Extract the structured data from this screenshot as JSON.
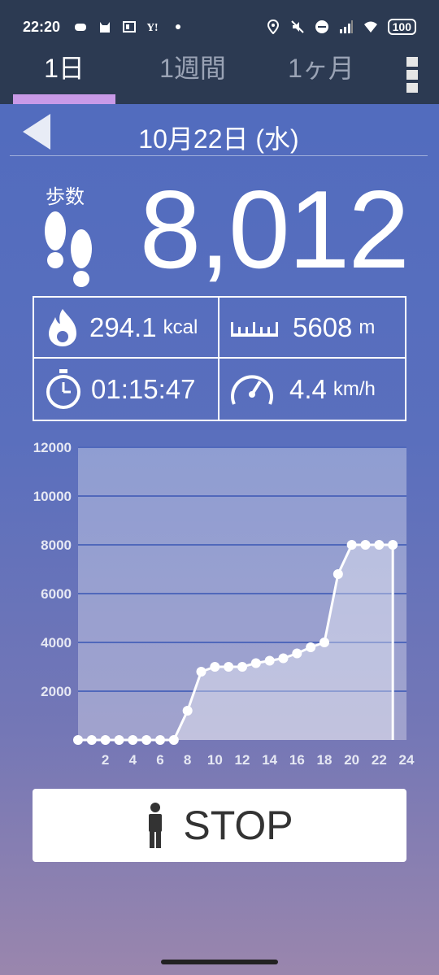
{
  "status": {
    "time": "22:20",
    "battery": "100"
  },
  "tabs": [
    {
      "label": "1日",
      "active": true
    },
    {
      "label": "1週間",
      "active": false
    },
    {
      "label": "1ヶ月",
      "active": false
    }
  ],
  "date": "10月22日 (水)",
  "steps": {
    "label": "歩数",
    "value": "8,012"
  },
  "stats": {
    "calories": {
      "value": "294.1",
      "unit": "kcal"
    },
    "distance": {
      "value": "5608",
      "unit": "m"
    },
    "duration": {
      "value": "01:15:47"
    },
    "speed": {
      "value": "4.4",
      "unit": "km/h"
    }
  },
  "stop_label": "STOP",
  "colors": {
    "header_bg": "#2c3a52",
    "tab_indicator": "#c99ae8"
  },
  "chart_data": {
    "type": "area",
    "x": [
      0,
      1,
      2,
      3,
      4,
      5,
      6,
      7,
      8,
      9,
      10,
      11,
      12,
      13,
      14,
      15,
      16,
      17,
      18,
      19,
      20,
      21,
      22,
      23
    ],
    "values": [
      0,
      0,
      0,
      0,
      0,
      0,
      0,
      0,
      1200,
      2800,
      3000,
      3000,
      3000,
      3150,
      3250,
      3350,
      3550,
      3800,
      4000,
      6800,
      8000,
      8000,
      8000,
      8000
    ],
    "y_ticks": [
      "2000",
      "4000",
      "6000",
      "8000",
      "10000",
      "12000"
    ],
    "x_ticks": [
      "2",
      "4",
      "6",
      "8",
      "10",
      "12",
      "14",
      "16",
      "18",
      "20",
      "22",
      "24"
    ],
    "ylim": [
      0,
      12000
    ],
    "xlim": [
      0,
      24
    ],
    "grid": true
  }
}
